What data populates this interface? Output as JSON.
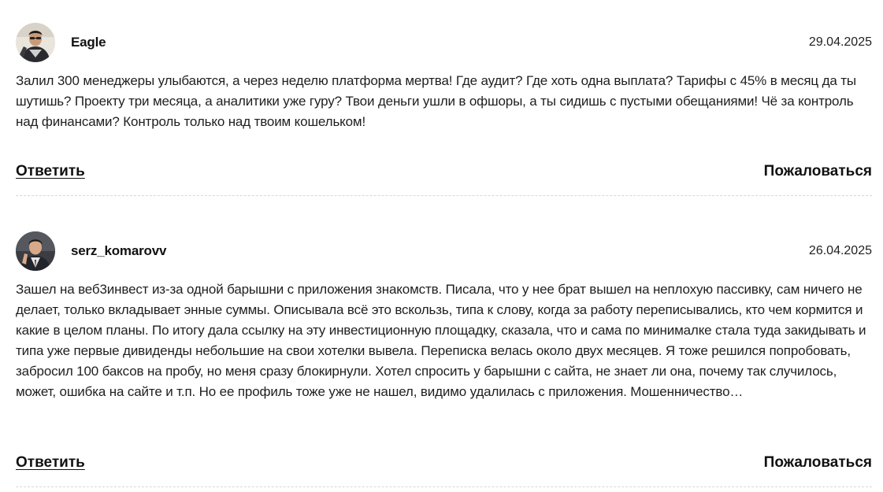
{
  "comments": [
    {
      "author": "Eagle",
      "date": "29.04.2025",
      "text": "Залил 300 менеджеры улыбаются, а через неделю платформа мертва! Где аудит? Где хоть одна выплата? Тарифы с 45% в месяц да ты шутишь? Проекту три месяца, а аналитики уже гуру? Твои деньги ушли в офшоры, а ты сидишь с пустыми обещаниями! Чё за контроль над финансами? Контроль только над твоим кошельком!",
      "reply_label": "Ответить",
      "report_label": "Пожаловаться",
      "avatar_icon": "user-avatar-photo"
    },
    {
      "author": "serz_komarovv",
      "date": "26.04.2025",
      "text": "Зашел на веб3инвест из-за одной барышни с приложения знакомств. Писала, что у нее брат вышел на неплохую пассивку, сам ничего не делает, только вкладывает энные суммы. Описывала всё это вскользь, типа к слову, когда за работу переписывались, кто чем кормится и какие в целом планы. По итогу дала ссылку на эту инвестиционную площадку, сказала, что и сама по минималке стала туда закидывать и типа уже первые дивиденды небольшие на свои хотелки вывела. Переписка велась около двух месяцев. Я тоже решился попробовать, забросил 100 баксов на пробу, но меня сразу блокирнули. Хотел спросить у барышни с сайта, не знает ли она, почему так случилось, может, ошибка на сайте и т.п. Но ее профиль тоже уже не нашел, видимо удалилась с приложения. Мошенничество…",
      "reply_label": "Ответить",
      "report_label": "Пожаловаться",
      "avatar_icon": "user-avatar-photo"
    }
  ]
}
